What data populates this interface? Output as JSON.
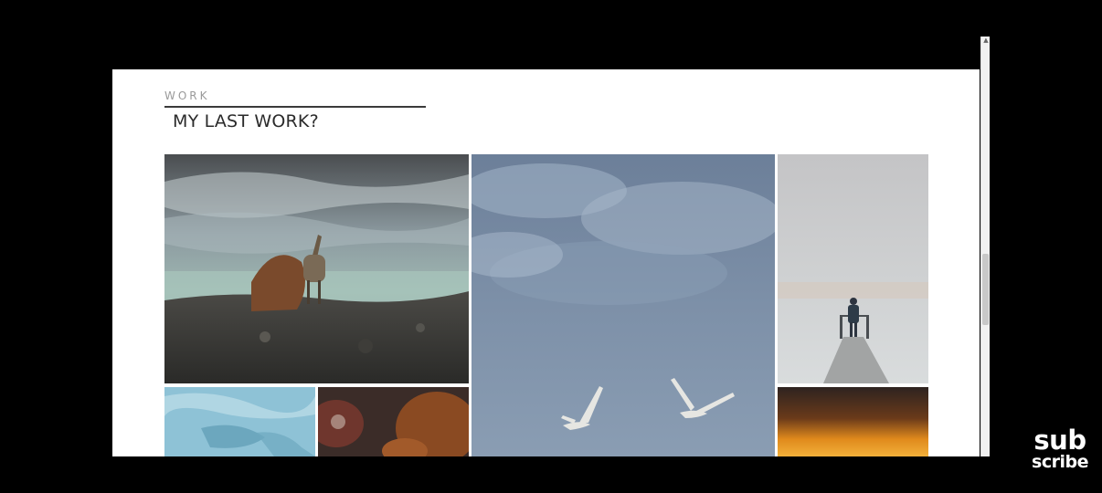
{
  "section": {
    "eyebrow": "WORK",
    "title": "MY LAST WORK?"
  },
  "gallery": {
    "items": [
      {
        "subject": "ibex by glacier"
      },
      {
        "subject": "seagulls in cloudy sky"
      },
      {
        "subject": "person on pier in fog"
      },
      {
        "subject": "blue ice"
      },
      {
        "subject": "red bird closeup"
      },
      {
        "subject": "orange sunset sky"
      }
    ]
  },
  "overlay": {
    "brand_line1": "sub",
    "brand_line2": "scribe"
  }
}
